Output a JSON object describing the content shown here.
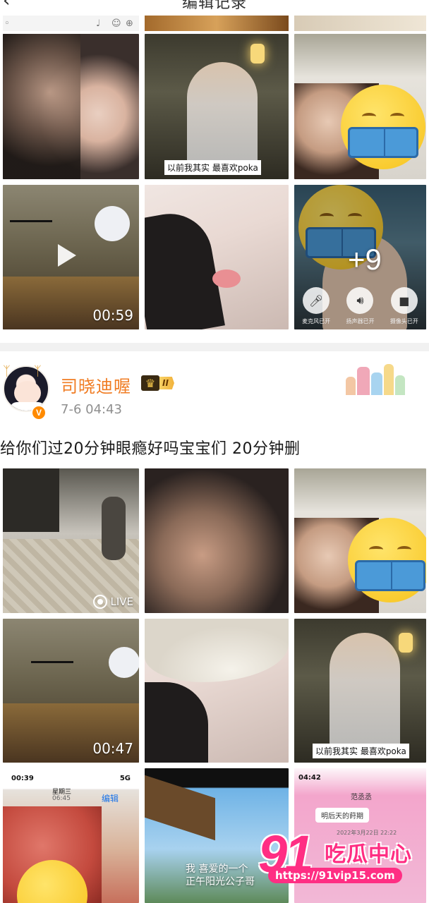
{
  "header": {
    "title": "编辑记录",
    "back_icon": "chevron-left-icon"
  },
  "strip1": {
    "icons": [
      "pin-icon",
      "mic-icon",
      "emoji-icon",
      "plus-icon"
    ]
  },
  "grid1": {
    "tile2_caption": "以前我其实 最喜欢poka",
    "tile4_duration": "00:59",
    "tile6_more": "+9",
    "tile6_call_labels": [
      "麦克风已开",
      "扬声器已开",
      "摄像头已开"
    ]
  },
  "post": {
    "username": "司晓迪喔",
    "vip_level": "II",
    "timestamp": "7-6 04:43",
    "verified_badge": "V",
    "text": "给你们过20分钟眼瘾好吗宝宝们 20分钟删"
  },
  "grid2": {
    "tile1_live": "LIVE",
    "tile4_duration": "00:47",
    "tile6_caption": "以前我其实 最喜欢poka"
  },
  "grid3": {
    "tile1_time": "00:39",
    "tile1_network": "5G",
    "tile1_day": "星期三",
    "tile1_clock": "06:45",
    "tile1_edit": "编辑",
    "tile2_caption": "我 喜爱的一个\n正午阳光公子哥",
    "tile3_time": "04:42",
    "tile3_title": "范丞丞",
    "tile3_bubble": "明后天的莳期",
    "tile3_date": "2022年3月22日 22:22"
  },
  "watermark": {
    "number": "91",
    "name": "吃瓜中心",
    "url": "https://91vip15.com"
  },
  "colors": {
    "accent": "#f07c23",
    "watermark": "#ff2e83",
    "verified": "#ff8a00"
  }
}
